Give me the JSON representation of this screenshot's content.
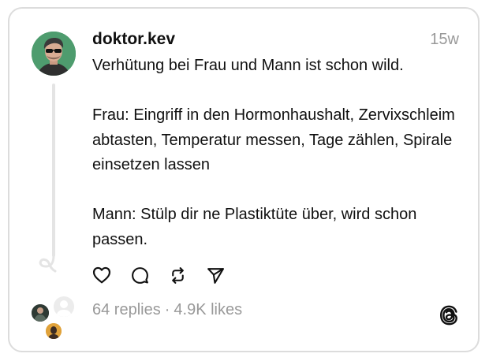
{
  "post": {
    "username": "doktor.kev",
    "time": "15w",
    "paragraphs": [
      "Verhütung bei Frau und Mann ist schon wild.",
      "Frau: Eingriff in den Hormonhaushalt, Zervixschleim abtasten, Temperatur messen, Tage zählen, Spirale einsetzen lassen",
      "Mann: Stülp dir ne Plastiktüte über, wird schon passen."
    ]
  },
  "actions": [
    {
      "name": "like",
      "icon": "heart-icon"
    },
    {
      "name": "reply",
      "icon": "comment-icon"
    },
    {
      "name": "repost",
      "icon": "repost-icon"
    },
    {
      "name": "share",
      "icon": "send-icon"
    }
  ],
  "stats": {
    "replies": "64 replies",
    "separator": "·",
    "likes": "4.9K likes"
  },
  "icons": {
    "brand": "threads-logo-icon"
  },
  "colors": {
    "text": "#101010",
    "muted": "#999999",
    "border": "#dcdcdc",
    "avatar_bg": "#4e9c6e"
  }
}
